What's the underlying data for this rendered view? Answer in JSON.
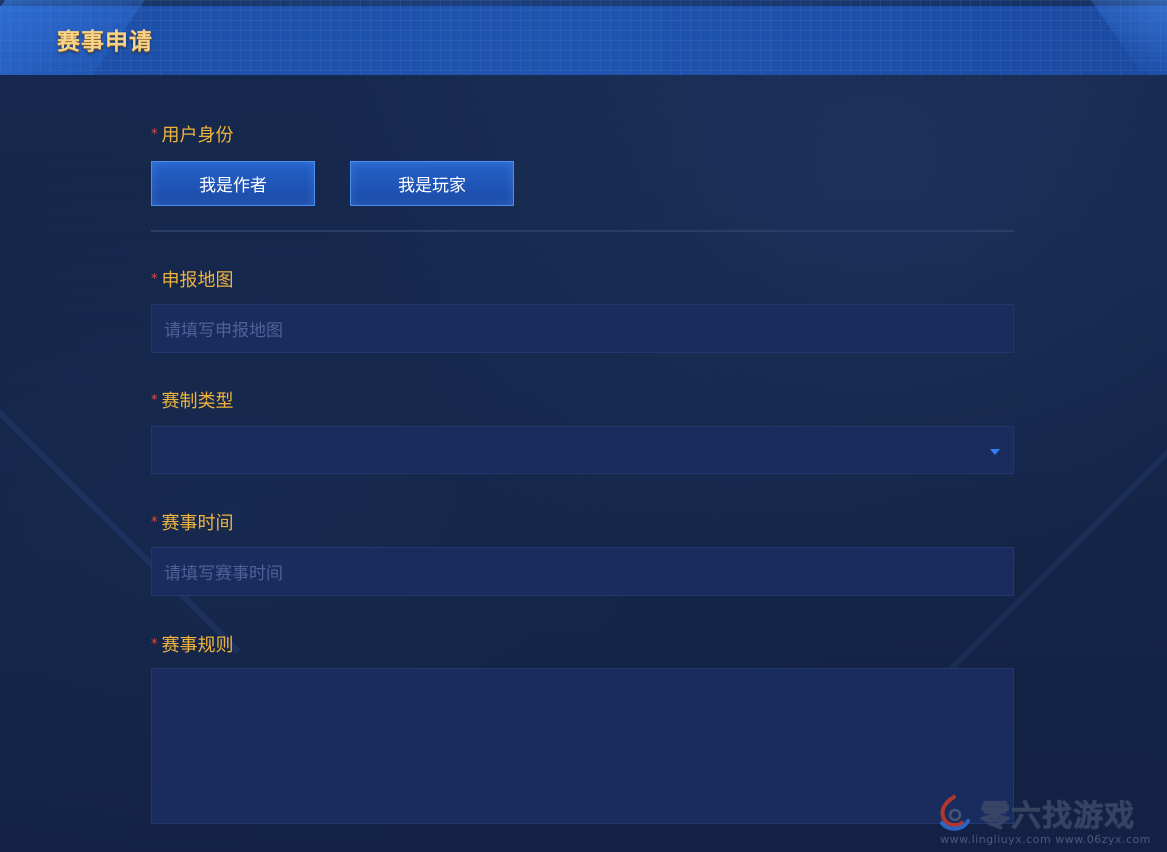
{
  "header": {
    "title": "赛事申请"
  },
  "form": {
    "identity": {
      "label": "用户身份",
      "required_mark": "*",
      "options": [
        "我是作者",
        "我是玩家"
      ]
    },
    "map": {
      "label": "申报地图",
      "required_mark": "*",
      "placeholder": "请填写申报地图"
    },
    "format": {
      "label": "赛制类型",
      "required_mark": "*",
      "value": ""
    },
    "time": {
      "label": "赛事时间",
      "required_mark": "*",
      "placeholder": "请填写赛事时间"
    },
    "rules": {
      "label": "赛事规则",
      "required_mark": "*",
      "value": ""
    }
  },
  "watermark": {
    "brand": "零六找游戏",
    "urls": "www.lingliuyx.com    www.06zyx.com"
  },
  "colors": {
    "label": "#f0b33c",
    "required": "#e84b3c",
    "title": "#f7d48a",
    "input_bg": "#1a2c5e",
    "button_bg": "#1f54b0"
  }
}
